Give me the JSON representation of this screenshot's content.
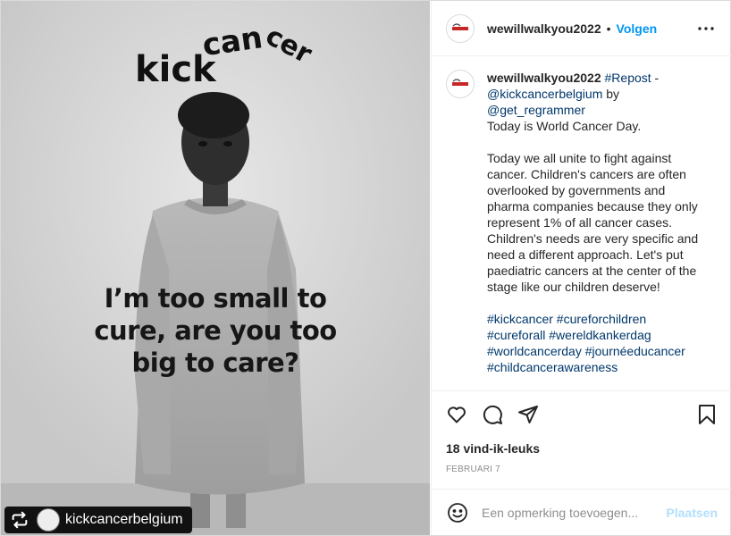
{
  "media": {
    "brand_word_kick": "kick",
    "brand_word_can": "can",
    "brand_word_cer": "cer",
    "headline_lines": [
      "I’m too small to",
      "cure, are you too",
      "big to care?"
    ],
    "repost_username": "kickcancerbelgium"
  },
  "header": {
    "username": "wewillwalkyou2022",
    "separator": "•",
    "follow_label": "Volgen"
  },
  "caption": {
    "username": "wewillwalkyou2022",
    "repost_tag": "#Repost",
    "dash": " - ",
    "mention_source": "@kickcancerbelgium",
    "by_text": " by ",
    "mention_app": "@get_regrammer",
    "line1": "Today is World Cancer Day.",
    "paragraph2": "Today we all unite to fight against cancer. Children's cancers are often overlooked by governments and pharma companies because they only represent 1% of all cancer cases. Children's needs are very specific and need a different approach. Let's put paediatric cancers at the center of the stage like our children deserve!",
    "hashtags_line1": "#kickcancer #cureforchildren",
    "hashtags_line2": "#cureforall #wereldkankerdag",
    "hashtags_line3": "#worldcancerday #journéeducancer",
    "hashtags_line4": "#childcancerawareness"
  },
  "actions": {
    "likes_text": "18 vind-ik-leuks",
    "date_text": "FEBRUARI 7"
  },
  "comment_box": {
    "placeholder": "Een opmerking toevoegen...",
    "post_label": "Plaatsen"
  },
  "icons": {
    "like": "heart-icon",
    "comment": "comment-bubble-icon",
    "share": "paper-plane-icon",
    "save": "bookmark-icon",
    "more": "more-dots-icon",
    "emoji": "emoji-smile-icon",
    "repost": "repost-icon"
  },
  "colors": {
    "follow": "#0095f6",
    "hashtag": "#00376b",
    "post_disabled": "#b2dffc",
    "muted": "#8e8e8e"
  }
}
